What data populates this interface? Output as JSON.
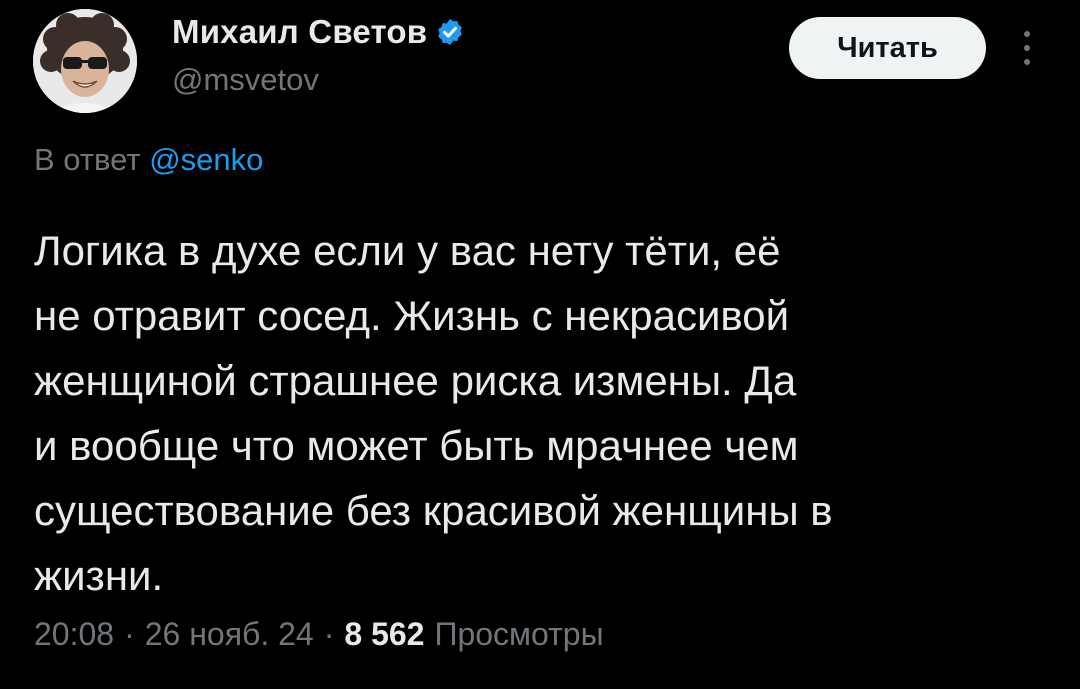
{
  "author": {
    "display_name": "Михаил Светов",
    "handle": "@msvetov",
    "verified": true,
    "avatar_alt": "profile photo"
  },
  "header": {
    "follow_label": "Читать",
    "more_icon": "more-vertical-icon"
  },
  "reply": {
    "prefix": "В ответ",
    "to_handle": "@senko"
  },
  "tweet": {
    "lines": [
      "Логика в духе если у вас нету тёти, её",
      "не отравит сосед. Жизнь с некрасивой",
      "женщиной страшнее риска измены. Да",
      "и вообще что может быть мрачнее чем",
      "существование без красивой женщины в",
      "жизни."
    ]
  },
  "meta": {
    "time": "20:08",
    "separator": "·",
    "date": "26 нояб. 24",
    "views_count": "8 562",
    "views_label": "Просмотры"
  },
  "colors": {
    "background": "#000000",
    "text": "#e7e9ea",
    "secondary": "#71767b",
    "link": "#1d9bf0",
    "verified": "#1d9bf0",
    "button_bg": "#eff3f4"
  }
}
